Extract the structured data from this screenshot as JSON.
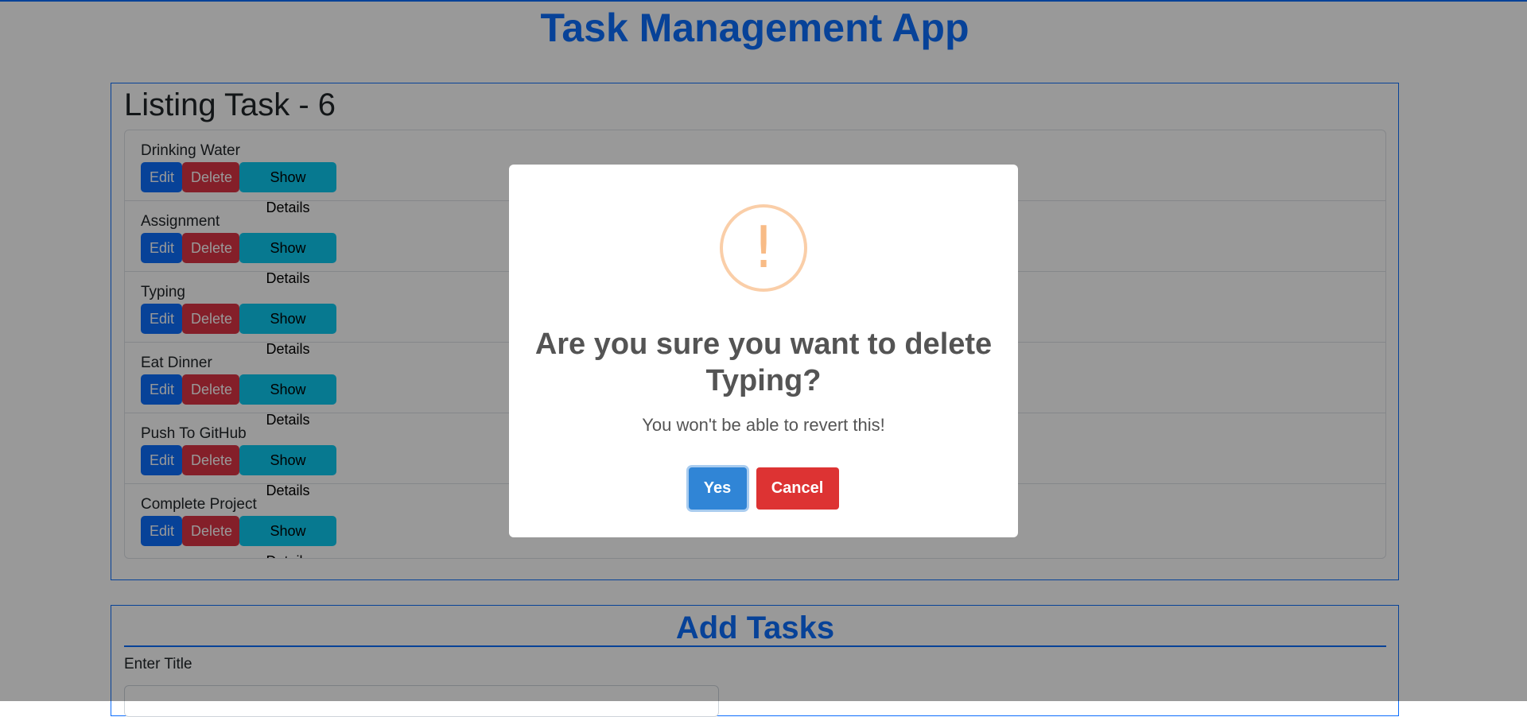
{
  "app": {
    "title": "Task Management App"
  },
  "listing": {
    "title": "Listing Task - 6",
    "tasks": [
      {
        "name": "Drinking Water"
      },
      {
        "name": "Assignment"
      },
      {
        "name": "Typing"
      },
      {
        "name": "Eat Dinner"
      },
      {
        "name": "Push To GitHub"
      },
      {
        "name": "Complete Project"
      }
    ],
    "buttons": {
      "edit": "Edit",
      "delete": "Delete",
      "details": "Show Details"
    }
  },
  "add_tasks": {
    "title": "Add Tasks",
    "title_label": "Enter Title",
    "title_value": ""
  },
  "dialog": {
    "icon": "warning-icon",
    "icon_glyph": "!",
    "title": "Are you sure you want to delete Typing?",
    "text": "You won't be able to revert this!",
    "confirm_label": "Yes",
    "cancel_label": "Cancel"
  },
  "colors": {
    "primary": "#0d6efd",
    "danger": "#dc3545",
    "info": "#0dcaf0",
    "confirm": "#3085d6",
    "cancel": "#dd3333",
    "warning_icon": "#f8bb86"
  }
}
